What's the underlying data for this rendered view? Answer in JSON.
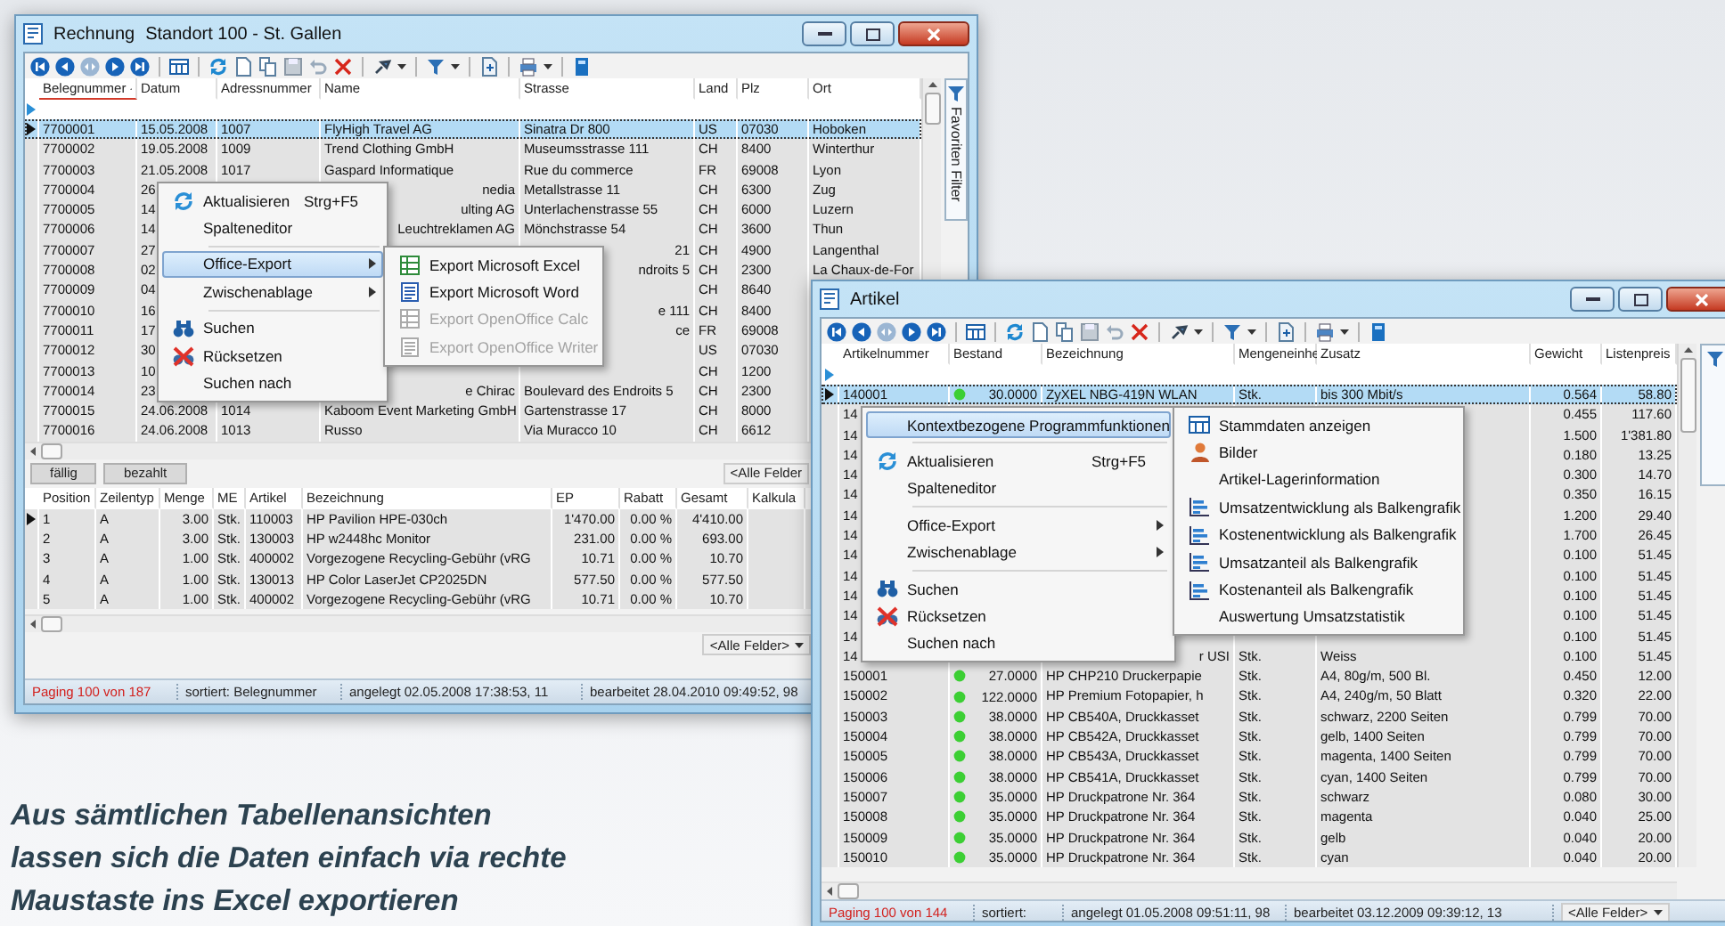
{
  "invoice_window": {
    "title": "Rechnung",
    "subtitle": "Standort 100 - St. Gallen",
    "table": {
      "columns": [
        {
          "label": "Belegnummer",
          "sorted": true
        },
        {
          "label": "Datum",
          "sorted": false
        },
        {
          "label": "Adressnummer",
          "sorted": false
        },
        {
          "label": "Name",
          "sorted": false
        },
        {
          "label": "Strasse",
          "sorted": false
        },
        {
          "label": "Land",
          "sorted": false
        },
        {
          "label": "Plz",
          "sorted": false
        },
        {
          "label": "Ort",
          "sorted": false
        }
      ],
      "rows": [
        {
          "selected": true,
          "cells": [
            "7700001",
            "15.05.2008",
            "1007",
            "FlyHigh Travel AG",
            "Sinatra Dr 800",
            "US",
            "07030",
            "Hoboken"
          ]
        },
        {
          "selected": false,
          "cells": [
            "7700002",
            "19.05.2008",
            "1009",
            "Trend Clothing GmbH",
            "Museumsstrasse 111",
            "CH",
            "8400",
            "Winterthur"
          ]
        },
        {
          "selected": false,
          "cells": [
            "7700003",
            "21.05.2008",
            "1017",
            "Gaspard Informatique",
            "Rue du commerce",
            "FR",
            "69008",
            "Lyon"
          ]
        },
        {
          "selected": false,
          "cells": [
            "7700004",
            "26",
            null,
            {
              "text": "nedia",
              "clipped": true
            },
            "Metallstrasse 11",
            "CH",
            "6300",
            "Zug"
          ]
        },
        {
          "selected": false,
          "cells": [
            "7700005",
            "14",
            null,
            {
              "text": "ulting AG",
              "clipped": true
            },
            "Unterlachenstrasse 55",
            "CH",
            "6000",
            "Luzern"
          ]
        },
        {
          "selected": false,
          "cells": [
            "7700006",
            "14",
            null,
            {
              "text": "Leuchtreklamen AG",
              "clipped": true
            },
            "Mönchstrasse 54",
            "CH",
            "3600",
            "Thun"
          ]
        },
        {
          "selected": false,
          "cells": [
            "7700007",
            "27",
            null,
            null,
            {
              "text": "21",
              "clipped": true
            },
            "CH",
            "4900",
            "Langenthal"
          ]
        },
        {
          "selected": false,
          "cells": [
            "7700008",
            "02",
            null,
            null,
            {
              "text": "ndroits 5",
              "clipped": true
            },
            "CH",
            "2300",
            "La Chaux-de-For"
          ]
        },
        {
          "selected": false,
          "cells": [
            "7700009",
            "04",
            null,
            null,
            null,
            "CH",
            "8640",
            null
          ]
        },
        {
          "selected": false,
          "cells": [
            "7700010",
            "16",
            null,
            null,
            {
              "text": "e 111",
              "clipped": true
            },
            "CH",
            "8400",
            null
          ]
        },
        {
          "selected": false,
          "cells": [
            "7700011",
            "17",
            null,
            null,
            {
              "text": "ce",
              "clipped": true
            },
            "FR",
            "69008",
            null
          ]
        },
        {
          "selected": false,
          "cells": [
            "7700012",
            "30",
            null,
            null,
            null,
            "US",
            "07030",
            null
          ]
        },
        {
          "selected": false,
          "cells": [
            "7700013",
            "10",
            null,
            null,
            null,
            "CH",
            "1200",
            null
          ]
        },
        {
          "selected": false,
          "cells": [
            "7700014",
            "23",
            null,
            {
              "text": "e Chirac",
              "clipped": true
            },
            "Boulevard des Endroits 5",
            "CH",
            "2300",
            null
          ]
        },
        {
          "selected": false,
          "cells": [
            "7700015",
            "24.06.2008",
            "1014",
            "Kaboom Event Marketing GmbH",
            "Gartenstrasse 17",
            "CH",
            "8000",
            null
          ]
        },
        {
          "selected": false,
          "cells": [
            "7700016",
            "24.06.2008",
            "1013",
            "Russo",
            "Via Muracco 10",
            "CH",
            "6612",
            null
          ]
        }
      ]
    },
    "side_tab": "Favoriten Filter",
    "detail_tabs": [
      "fällig",
      "bezahlt"
    ],
    "field_selector_top": "<Alle Felder",
    "detail_table": {
      "columns": [
        "Position",
        "Zeilentyp",
        "Menge",
        "ME",
        "Artikel",
        "Bezeichnung",
        "EP",
        "Rabatt",
        "Gesamt",
        "Kalkula"
      ],
      "rows": [
        {
          "current": true,
          "cells": [
            "1",
            "A",
            "3.00",
            "Stk.",
            "110003",
            "HP Pavilion HPE-030ch",
            "1'470.00",
            "0.00 %",
            "4'410.00",
            null
          ]
        },
        {
          "current": false,
          "cells": [
            "2",
            "A",
            "3.00",
            "Stk.",
            "130003",
            "HP w2448hc Monitor",
            "231.00",
            "0.00 %",
            "693.00",
            null
          ]
        },
        {
          "current": false,
          "cells": [
            "3",
            "A",
            "1.00",
            "Stk.",
            "400002",
            "Vorgezogene Recycling-Gebühr (vRG",
            "10.71",
            "0.00 %",
            "10.70",
            null
          ]
        },
        {
          "current": false,
          "cells": [
            "4",
            "A",
            "1.00",
            "Stk.",
            "130013",
            "HP Color LaserJet CP2025DN",
            "577.50",
            "0.00 %",
            "577.50",
            null
          ]
        },
        {
          "current": false,
          "cells": [
            "5",
            "A",
            "1.00",
            "Stk.",
            "400002",
            "Vorgezogene Recycling-Gebühr (vRG",
            "10.71",
            "0.00 %",
            "10.70",
            null
          ]
        }
      ]
    },
    "field_selector_bottom": "<Alle Felder>",
    "status_bar": [
      {
        "text": "Paging 100 von 187",
        "alert": true
      },
      {
        "text": "sortiert: Belegnummer",
        "alert": false
      },
      {
        "text": "angelegt 02.05.2008 17:38:53, 11",
        "alert": false
      },
      {
        "text": "bearbeitet 28.04.2010 09:49:52, 98",
        "alert": false
      }
    ],
    "context_menu": [
      {
        "kind": "item",
        "label": "Aktualisieren",
        "shortcut": "Strg+F5",
        "selected": false,
        "submenu": false
      },
      {
        "kind": "item",
        "label": "Spalteneditor",
        "selected": false,
        "submenu": false
      },
      {
        "kind": "separator"
      },
      {
        "kind": "item",
        "label": "Office-Export",
        "selected": true,
        "submenu": true
      },
      {
        "kind": "item",
        "label": "Zwischenablage",
        "selected": false,
        "submenu": true
      },
      {
        "kind": "separator"
      },
      {
        "kind": "item",
        "label": "Suchen",
        "selected": false,
        "submenu": false
      },
      {
        "kind": "item",
        "label": "Rücksetzen",
        "selected": false,
        "submenu": false
      },
      {
        "kind": "item",
        "label": "Suchen nach",
        "selected": false,
        "submenu": false
      }
    ],
    "submenu": [
      {
        "kind": "item",
        "label": "Export Microsoft Excel",
        "selected": false,
        "disabled": false
      },
      {
        "kind": "item",
        "label": "Export Microsoft Word",
        "selected": false,
        "disabled": false
      },
      {
        "kind": "item",
        "label": "Export OpenOffice Calc",
        "selected": false,
        "disabled": true
      },
      {
        "kind": "item",
        "label": "Export OpenOffice Writer",
        "selected": false,
        "disabled": true
      }
    ]
  },
  "article_window": {
    "title": "Artikel",
    "table": {
      "columns": [
        "Artikelnummer",
        "Bestand",
        "Bezeichnung",
        "Mengeneinhe",
        "Zusatz",
        "Gewicht",
        "Listenpreis"
      ],
      "rows": [
        {
          "selected": true,
          "cells": [
            "140001",
            {
              "in_stock": true,
              "text": "30.0000"
            },
            "ZyXEL NBG-419N WLAN",
            "Stk.",
            "bis 300 Mbit/s",
            "0.564",
            "58.80"
          ]
        },
        {
          "selected": false,
          "cells": [
            "14",
            null,
            null,
            null,
            null,
            "0.455",
            "117.60"
          ]
        },
        {
          "selected": false,
          "cells": [
            "14",
            null,
            null,
            null,
            null,
            "1.500",
            "1'381.80"
          ]
        },
        {
          "selected": false,
          "cells": [
            "14",
            null,
            null,
            null,
            null,
            "0.180",
            "13.25"
          ]
        },
        {
          "selected": false,
          "cells": [
            "14",
            null,
            null,
            null,
            null,
            "0.300",
            "14.70"
          ]
        },
        {
          "selected": false,
          "cells": [
            "14",
            null,
            null,
            null,
            null,
            "0.350",
            "16.15"
          ]
        },
        {
          "selected": false,
          "cells": [
            "14",
            null,
            null,
            null,
            null,
            "1.200",
            "29.40"
          ]
        },
        {
          "selected": false,
          "cells": [
            "14",
            null,
            null,
            null,
            null,
            "1.700",
            "26.45"
          ]
        },
        {
          "selected": false,
          "cells": [
            "14",
            null,
            null,
            null,
            null,
            "0.100",
            "51.45"
          ]
        },
        {
          "selected": false,
          "cells": [
            "14",
            null,
            null,
            null,
            null,
            "0.100",
            "51.45"
          ]
        },
        {
          "selected": false,
          "cells": [
            "14",
            null,
            null,
            null,
            null,
            "0.100",
            "51.45"
          ]
        },
        {
          "selected": false,
          "cells": [
            "14",
            null,
            null,
            null,
            null,
            "0.100",
            "51.45"
          ]
        },
        {
          "selected": false,
          "cells": [
            "14",
            null,
            null,
            null,
            null,
            "0.100",
            "51.45"
          ]
        },
        {
          "selected": false,
          "cells": [
            "14",
            null,
            {
              "text": "r USI",
              "clipped": true
            },
            "Stk.",
            "Weiss",
            "0.100",
            "51.45"
          ]
        },
        {
          "selected": false,
          "cells": [
            "150001",
            {
              "in_stock": true,
              "text": "27.0000"
            },
            "HP CHP210 Druckerpapie",
            "Stk.",
            "A4, 80g/m, 500 Bl.",
            "0.450",
            "12.00"
          ]
        },
        {
          "selected": false,
          "cells": [
            "150002",
            {
              "in_stock": true,
              "text": "122.0000"
            },
            "HP Premium Fotopapier, h",
            "Stk.",
            "A4, 240g/m, 50 Blatt",
            "0.320",
            "22.00"
          ]
        },
        {
          "selected": false,
          "cells": [
            "150003",
            {
              "in_stock": true,
              "text": "38.0000"
            },
            "HP CB540A, Druckkasset",
            "Stk.",
            "schwarz, 2200 Seiten",
            "0.799",
            "70.00"
          ]
        },
        {
          "selected": false,
          "cells": [
            "150004",
            {
              "in_stock": true,
              "text": "38.0000"
            },
            "HP CB542A, Druckkasset",
            "Stk.",
            "gelb, 1400 Seiten",
            "0.799",
            "70.00"
          ]
        },
        {
          "selected": false,
          "cells": [
            "150005",
            {
              "in_stock": true,
              "text": "38.0000"
            },
            "HP CB543A, Druckkasset",
            "Stk.",
            "magenta, 1400 Seiten",
            "0.799",
            "70.00"
          ]
        },
        {
          "selected": false,
          "cells": [
            "150006",
            {
              "in_stock": true,
              "text": "38.0000"
            },
            "HP CB541A, Druckkasset",
            "Stk.",
            "cyan, 1400 Seiten",
            "0.799",
            "70.00"
          ]
        },
        {
          "selected": false,
          "cells": [
            "150007",
            {
              "in_stock": true,
              "text": "35.0000"
            },
            "HP Druckpatrone Nr. 364",
            "Stk.",
            "schwarz",
            "0.080",
            "30.00"
          ]
        },
        {
          "selected": false,
          "cells": [
            "150008",
            {
              "in_stock": true,
              "text": "35.0000"
            },
            "HP Druckpatrone Nr. 364",
            "Stk.",
            "magenta",
            "0.040",
            "25.00"
          ]
        },
        {
          "selected": false,
          "cells": [
            "150009",
            {
              "in_stock": true,
              "text": "35.0000"
            },
            "HP Druckpatrone Nr. 364",
            "Stk.",
            "gelb",
            "0.040",
            "20.00"
          ]
        },
        {
          "selected": false,
          "cells": [
            "150010",
            {
              "in_stock": true,
              "text": "35.0000"
            },
            "HP Druckpatrone Nr. 364",
            "Stk.",
            "cyan",
            "0.040",
            "20.00"
          ]
        }
      ]
    },
    "status_bar": [
      {
        "text": "Paging 100 von 144",
        "alert": true
      },
      {
        "text": "sortiert:",
        "alert": false
      },
      {
        "text": "angelegt 01.05.2008 09:51:11, 98",
        "alert": false
      },
      {
        "text": "bearbeitet 03.12.2009 09:39:12, 13",
        "alert": false
      }
    ],
    "field_selector": "<Alle Felder>",
    "context_menu": [
      {
        "kind": "item",
        "label": "Kontextbezogene Programmfunktionen",
        "selected": true,
        "submenu": true
      },
      {
        "kind": "separator"
      },
      {
        "kind": "item",
        "label": "Aktualisieren",
        "shortcut": "Strg+F5",
        "selected": false,
        "submenu": false
      },
      {
        "kind": "item",
        "label": "Spalteneditor",
        "selected": false,
        "submenu": false
      },
      {
        "kind": "separator"
      },
      {
        "kind": "item",
        "label": "Office-Export",
        "selected": false,
        "submenu": true
      },
      {
        "kind": "item",
        "label": "Zwischenablage",
        "selected": false,
        "submenu": true
      },
      {
        "kind": "separator"
      },
      {
        "kind": "item",
        "label": "Suchen",
        "selected": false,
        "submenu": false
      },
      {
        "kind": "item",
        "label": "Rücksetzen",
        "selected": false,
        "submenu": false
      },
      {
        "kind": "item",
        "label": "Suchen nach",
        "selected": false,
        "submenu": false
      }
    ],
    "submenu": [
      {
        "kind": "item",
        "label": "Stammdaten anzeigen",
        "selected": false
      },
      {
        "kind": "item",
        "label": "Bilder",
        "selected": false
      },
      {
        "kind": "item",
        "label": "Artikel-Lagerinformation",
        "selected": false
      },
      {
        "kind": "item",
        "label": "Umsatzentwicklung als Balkengrafik",
        "selected": false
      },
      {
        "kind": "item",
        "label": "Kostenentwicklung als Balkengrafik",
        "selected": false
      },
      {
        "kind": "item",
        "label": "Umsatzanteil als Balkengrafik",
        "selected": false
      },
      {
        "kind": "item",
        "label": "Kostenanteil als Balkengrafik",
        "selected": false
      },
      {
        "kind": "item",
        "label": "Auswertung Umsatzstatistik",
        "selected": false
      }
    ]
  },
  "caption": "Aus sämtlichen Tabellenansichten lassen sich die Daten einfach via rechte Maustaste ins Excel exportieren"
}
